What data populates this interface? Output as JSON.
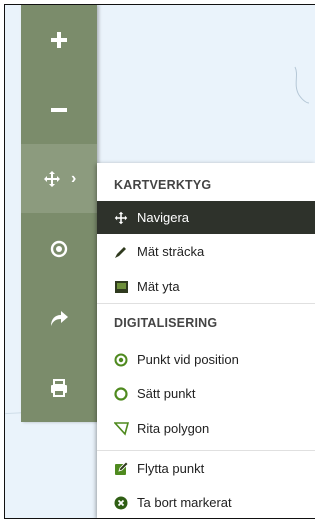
{
  "toolbar": {
    "tools": [
      {
        "name": "zoom-in",
        "icon": "plus-icon"
      },
      {
        "name": "zoom-out",
        "icon": "minus-icon"
      },
      {
        "name": "map-tools",
        "icon": "move-icon",
        "active": true
      },
      {
        "name": "locate",
        "icon": "target-icon"
      },
      {
        "name": "share",
        "icon": "share-arrow-icon"
      },
      {
        "name": "print",
        "icon": "printer-icon"
      }
    ]
  },
  "menu": {
    "section1_title": "KARTVERKTYG",
    "section2_title": "DIGITALISERING",
    "items": [
      {
        "label": "Navigera",
        "icon": "move-icon",
        "selected": true
      },
      {
        "label": "Mät sträcka",
        "icon": "ruler-pen-icon"
      },
      {
        "label": "Mät yta",
        "icon": "area-icon"
      },
      {
        "label": "Punkt vid position",
        "icon": "position-point-icon"
      },
      {
        "label": "Sätt punkt",
        "icon": "circle-point-icon"
      },
      {
        "label": "Rita polygon",
        "icon": "polygon-icon"
      },
      {
        "label": "Flytta punkt",
        "icon": "edit-icon"
      },
      {
        "label": "Ta bort markerat",
        "icon": "delete-icon"
      }
    ]
  },
  "colors": {
    "toolbar": "#7b8c6b",
    "toolbar_active": "#8c9b7e",
    "selected_item": "#2e322b",
    "accent_green": "#4f8a1f",
    "map_background": "#eaf3fb"
  }
}
